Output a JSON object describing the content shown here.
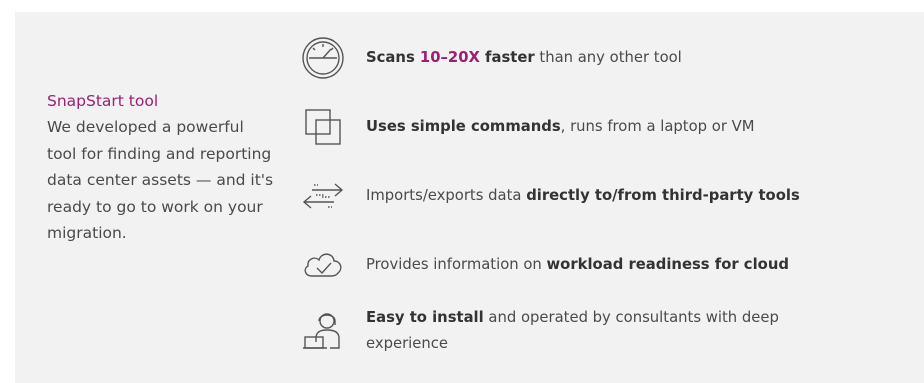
{
  "intro": {
    "title": "SnapStart tool",
    "body": "We developed a powerful tool for finding and reporting data center assets — and it's ready to go to work on your migration."
  },
  "features": [
    {
      "icon": "speedometer-icon",
      "parts": [
        {
          "t": "Scans ",
          "s": "b"
        },
        {
          "t": "10–20X",
          "s": "hl"
        },
        {
          "t": " faster",
          "s": "b"
        },
        {
          "t": " than any other tool",
          "s": ""
        }
      ]
    },
    {
      "icon": "overlapping-squares-icon",
      "parts": [
        {
          "t": "Uses simple commands",
          "s": "b"
        },
        {
          "t": ", runs from a laptop or VM",
          "s": ""
        }
      ]
    },
    {
      "icon": "data-transfer-arrows-icon",
      "parts": [
        {
          "t": "Imports/exports data ",
          "s": ""
        },
        {
          "t": "directly to/from third-party tools",
          "s": "b"
        }
      ]
    },
    {
      "icon": "cloud-check-icon",
      "parts": [
        {
          "t": "Provides information on ",
          "s": ""
        },
        {
          "t": "workload readiness for cloud",
          "s": "b"
        }
      ]
    },
    {
      "icon": "consultant-laptop-icon",
      "parts": [
        {
          "t": "Easy to install",
          "s": "b"
        },
        {
          "t": " and operated by consultants with deep experience",
          "s": ""
        }
      ]
    }
  ],
  "colors": {
    "accent": "#9b1f74",
    "panel": "#f2f2f2",
    "text": "#4a4a4a",
    "icon": "#555555"
  }
}
